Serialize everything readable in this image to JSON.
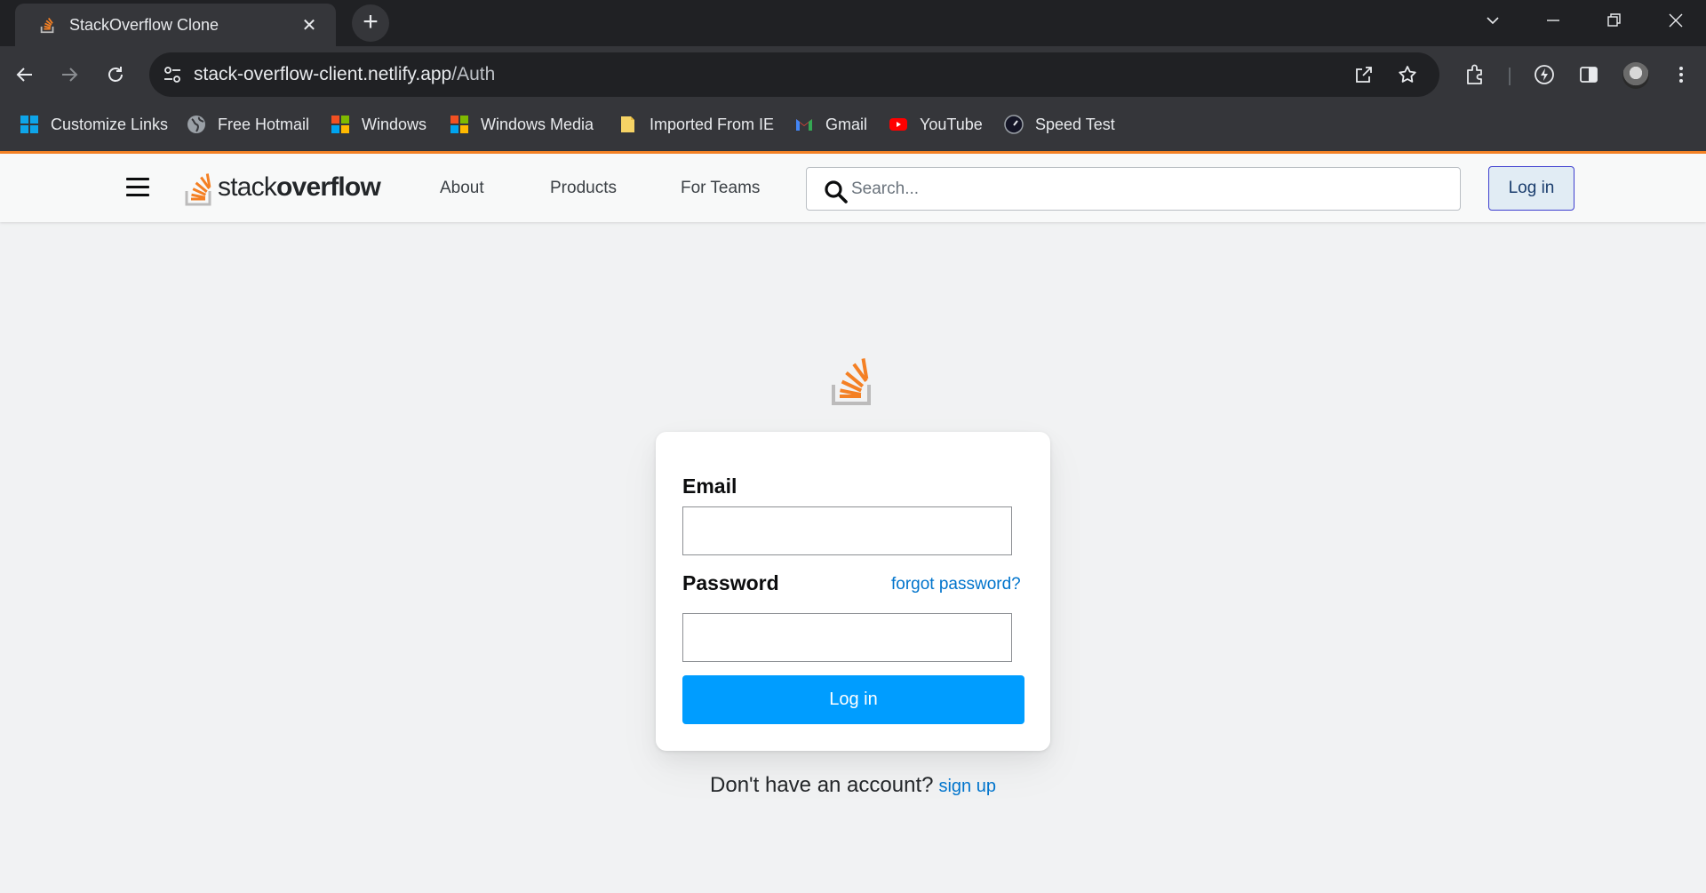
{
  "browser": {
    "tab_title": "StackOverflow Clone",
    "tab_close": "✕",
    "new_tab": "+",
    "url_host": "stack-overflow-client.netlify.app",
    "url_path": "/Auth",
    "bookmarks": [
      {
        "label": "Customize Links",
        "icon": "windows-logo-icon"
      },
      {
        "label": "Free Hotmail",
        "icon": "globe-icon"
      },
      {
        "label": "Windows",
        "icon": "windows-logo-icon"
      },
      {
        "label": "Windows Media",
        "icon": "windows-logo-icon"
      },
      {
        "label": "Imported From IE",
        "icon": "folder-icon"
      },
      {
        "label": "Gmail",
        "icon": "gmail-icon"
      },
      {
        "label": "YouTube",
        "icon": "youtube-icon"
      },
      {
        "label": "Speed Test",
        "icon": "speedometer-icon"
      }
    ]
  },
  "header": {
    "logo_light": "stack",
    "logo_bold": "overflow",
    "nav": {
      "about": "About",
      "products": "Products",
      "teams": "For Teams"
    },
    "search_placeholder": "Search...",
    "login_label": "Log in"
  },
  "auth": {
    "email_label": "Email",
    "password_label": "Password",
    "forgot_label": "forgot password?",
    "submit_label": "Log in",
    "signup_prompt": "Don't have an account?",
    "signup_link": "sign up"
  },
  "colors": {
    "accent_orange": "#f48225",
    "primary_button": "#009dff",
    "link_blue": "#0074cc"
  }
}
